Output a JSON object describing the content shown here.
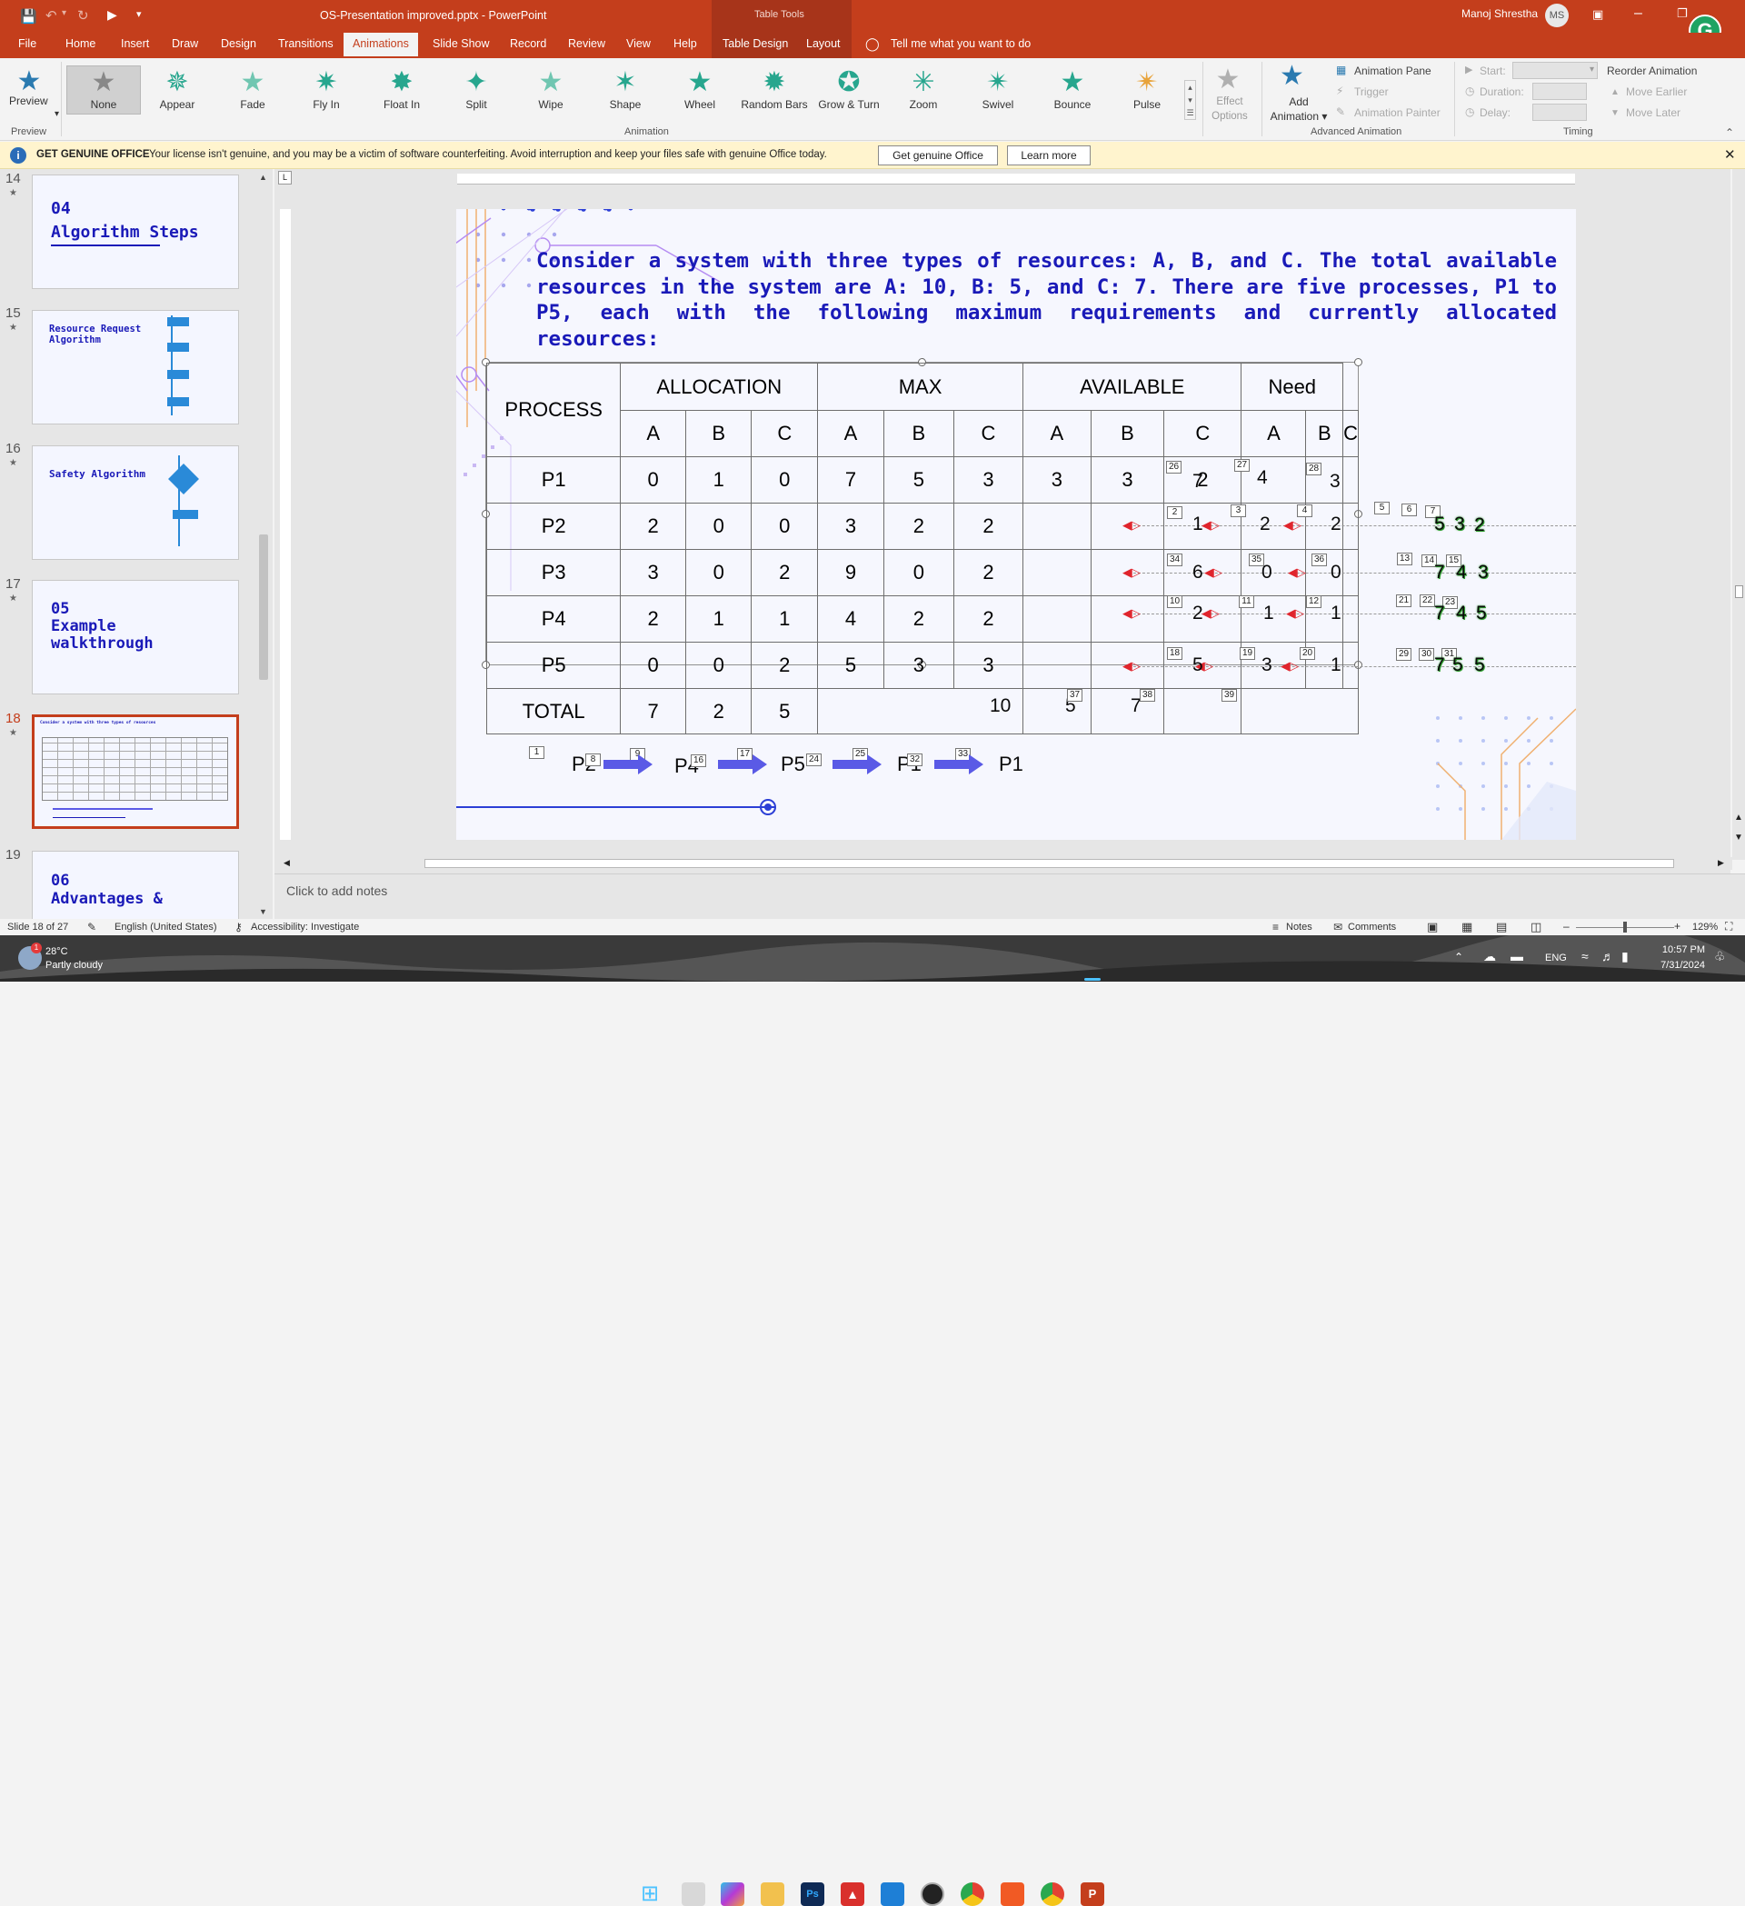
{
  "window": {
    "title": "OS-Presentation improved.pptx  -  PowerPoint",
    "table_tools": "Table Tools",
    "user_name": "Manoj Shrestha",
    "user_initials": "MS"
  },
  "tabs": [
    "File",
    "Home",
    "Insert",
    "Draw",
    "Design",
    "Transitions",
    "Animations",
    "Slide Show",
    "Record",
    "Review",
    "View",
    "Help",
    "Table Design",
    "Layout"
  ],
  "active_tab": "Animations",
  "tell_me": "Tell me what you want to do",
  "ribbon": {
    "preview_label": "Preview",
    "preview_group": "Preview",
    "animations": [
      "None",
      "Appear",
      "Fade",
      "Fly In",
      "Float In",
      "Split",
      "Wipe",
      "Shape",
      "Wheel",
      "Random Bars",
      "Grow & Turn",
      "Zoom",
      "Swivel",
      "Bounce",
      "Pulse"
    ],
    "animation_group": "Animation",
    "effect_options": [
      "Effect",
      "Options"
    ],
    "add_animation": [
      "Add",
      "Animation"
    ],
    "animation_pane": "Animation Pane",
    "trigger": "Trigger",
    "animation_painter": "Animation Painter",
    "advanced_group": "Advanced Animation",
    "start_label": "Start:",
    "duration_label": "Duration:",
    "delay_label": "Delay:",
    "timing_group": "Timing",
    "reorder_title": "Reorder Animation",
    "move_earlier": "Move Earlier",
    "move_later": "Move Later"
  },
  "info_bar": {
    "label": "GET GENUINE OFFICE",
    "message": "Your license isn't genuine, and you may be a victim of software counterfeiting. Avoid interruption and keep your files safe with genuine Office today.",
    "button1": "Get genuine Office",
    "button2": "Learn more"
  },
  "thumbnails": [
    {
      "num": "14",
      "title": "04\nAlgorithm Steps"
    },
    {
      "num": "15",
      "title": "Resource Request\nAlgorithm"
    },
    {
      "num": "16",
      "title": "Safety Algorithm"
    },
    {
      "num": "17",
      "title": "05\nExample\nwalkthrough"
    },
    {
      "num": "18",
      "title": "Consider a system with three types of resources"
    },
    {
      "num": "19",
      "title": "06\nAdvantages &"
    }
  ],
  "slide": {
    "intro": "Consider a system with three types of resources: A, B, and C. The total available resources in the system are A: 10, B: 5, and C: 7. There are five processes, P1 to P5, each with the following maximum requirements and currently allocated resources:",
    "group_headers": [
      "PROCESS",
      "ALLOCATION",
      "MAX",
      "AVAILABLE",
      "Need"
    ],
    "sub_headers": [
      "A",
      "B",
      "C",
      "A",
      "B",
      "C",
      "A",
      "B",
      "C",
      "A",
      "B",
      "C"
    ],
    "rows": [
      {
        "p": "P1",
        "alloc": [
          "0",
          "1",
          "0"
        ],
        "max": [
          "7",
          "5",
          "3"
        ],
        "avail": [
          "3",
          "3",
          "2"
        ],
        "need": [
          "7",
          "4",
          "3"
        ]
      },
      {
        "p": "P2",
        "alloc": [
          "2",
          "0",
          "0"
        ],
        "max": [
          "3",
          "2",
          "2"
        ],
        "avail": [
          "",
          "",
          ""
        ],
        "need": [
          "1",
          "2",
          "2"
        ]
      },
      {
        "p": "P3",
        "alloc": [
          "3",
          "0",
          "2"
        ],
        "max": [
          "9",
          "0",
          "2"
        ],
        "avail": [
          "",
          "",
          ""
        ],
        "need": [
          "6",
          "0",
          "0"
        ]
      },
      {
        "p": "P4",
        "alloc": [
          "2",
          "1",
          "1"
        ],
        "max": [
          "4",
          "2",
          "2"
        ],
        "avail": [
          "",
          "",
          ""
        ],
        "need": [
          "2",
          "1",
          "1"
        ]
      },
      {
        "p": "P5",
        "alloc": [
          "0",
          "0",
          "2"
        ],
        "max": [
          "5",
          "3",
          "3"
        ],
        "avail": [
          "",
          "",
          ""
        ],
        "need": [
          "5",
          "3",
          "1"
        ]
      }
    ],
    "total_label": "TOTAL",
    "total_alloc": [
      "7",
      "2",
      "5"
    ],
    "total_avail": [
      "10",
      "5",
      "7"
    ],
    "sequence": [
      "P2",
      "P4",
      "P5",
      "P1",
      "P1"
    ],
    "overflow_rows": [
      [
        "5",
        "3",
        "2"
      ],
      [
        "7",
        "4",
        "3"
      ],
      [
        "7",
        "4",
        "5"
      ],
      [
        "7",
        "5",
        "5"
      ]
    ],
    "markers": {
      "need_row1": [
        "26",
        "27",
        "28"
      ],
      "need_row2": [
        "2",
        "3",
        "4"
      ],
      "need_row3": [
        "34",
        "35",
        "36"
      ],
      "need_row4": [
        "10",
        "11",
        "12"
      ],
      "need_row5": [
        "18",
        "19",
        "20"
      ],
      "overflow_row2": [
        "5",
        "6",
        "7"
      ],
      "overflow_row3": [
        "13",
        "14",
        "15"
      ],
      "overflow_row4": [
        "21",
        "22",
        "23"
      ],
      "overflow_row5": [
        "29",
        "30",
        "31"
      ],
      "total": [
        "37",
        "38",
        "39"
      ],
      "sequence": [
        "1",
        "8",
        "9",
        "16",
        "17",
        "24",
        "25",
        "32",
        "33"
      ]
    }
  },
  "notes_placeholder": "Click to add notes",
  "status": {
    "slide_info": "Slide 18 of 27",
    "language": "English (United States)",
    "accessibility": "Accessibility: Investigate",
    "notes": "Notes",
    "comments": "Comments",
    "zoom": "129%"
  },
  "taskbar": {
    "weather_temp": "28°C",
    "weather_desc": "Partly cloudy",
    "lang": "ENG",
    "time": "10:57 PM",
    "date": "7/31/2024"
  },
  "colors": {
    "accent": "#c43e1c",
    "slide_text": "#1a1ab8",
    "arrow": "#5a5ae6",
    "motion_red": "#e0242c",
    "overflow_green": "#2e9e2e"
  }
}
